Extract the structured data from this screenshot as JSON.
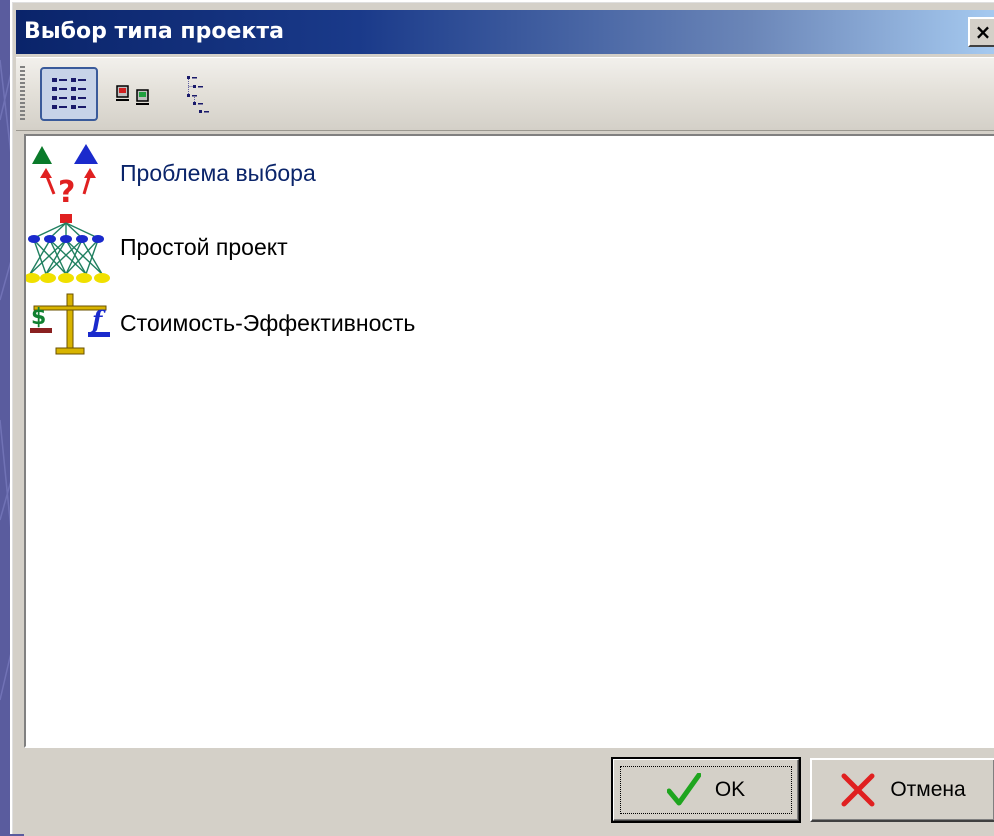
{
  "window": {
    "title": "Выбор типа проекта",
    "close_glyph": "×"
  },
  "toolbar": {
    "buttons": [
      {
        "name": "large-icons-view-button",
        "icon": "list-view-icon",
        "pressed": true
      },
      {
        "name": "small-icons-view-button",
        "icon": "small-icons-view-icon",
        "pressed": false
      },
      {
        "name": "tree-view-button",
        "icon": "tree-view-icon",
        "pressed": false
      }
    ]
  },
  "project_types": [
    {
      "label": "Проблема выбора",
      "icon": "choice-problem-icon",
      "selected": true
    },
    {
      "label": "Простой проект",
      "icon": "simple-project-icon",
      "selected": false
    },
    {
      "label": "Стоимость-Эффективность",
      "icon": "cost-effectiveness-icon",
      "selected": false
    }
  ],
  "footer": {
    "ok_label": "OK",
    "cancel_label": "Отмена"
  },
  "colors": {
    "titlebar_start": "#0a246a",
    "titlebar_end": "#a6caf0",
    "dialog_face": "#d4d0c8",
    "selected_text": "#0a246a",
    "ok_check": "#1fa51f",
    "cancel_cross": "#e02020"
  }
}
